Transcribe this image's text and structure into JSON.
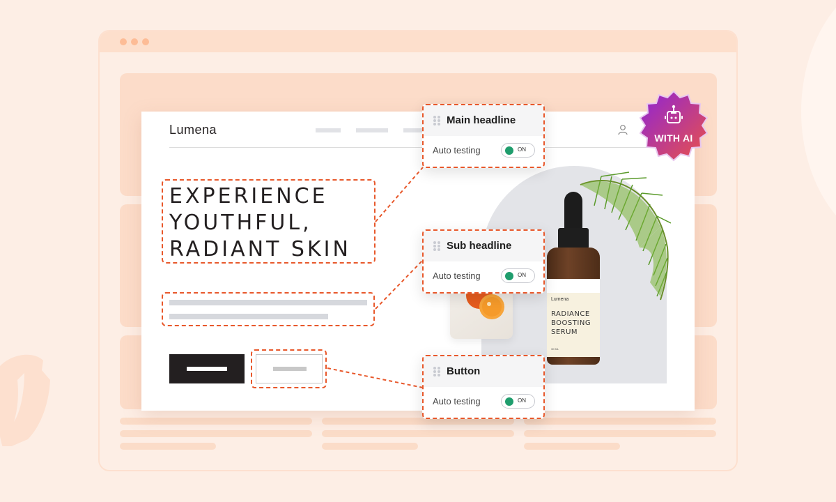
{
  "browser": {
    "window_dots": [
      "close",
      "minimize",
      "maximize"
    ]
  },
  "site": {
    "logo": "Lumena",
    "nav_item_count": 3,
    "user_icon": "user-icon",
    "hero": {
      "title_lines": [
        "EXPERIENCE",
        "YOUTHFUL,",
        "RADIANT SKIN"
      ]
    }
  },
  "product": {
    "brand": "Lumena",
    "name_lines": [
      "RADIANCE",
      "BOOSTING",
      "SERUM"
    ],
    "volume": "30 ML"
  },
  "panels": [
    {
      "title": "Main headline",
      "label": "Auto testing",
      "toggle": "ON",
      "toggle_state": true
    },
    {
      "title": "Sub headline",
      "label": "Auto testing",
      "toggle": "ON",
      "toggle_state": true
    },
    {
      "title": "Button",
      "label": "Auto testing",
      "toggle": "ON",
      "toggle_state": true
    }
  ],
  "badge": {
    "icon": "robot-icon",
    "text": "WITH AI"
  },
  "colors": {
    "accent_dashed": "#e8582b",
    "toggle_on": "#1f9d6d",
    "badge_gradient": [
      "#8e24d6",
      "#e8524b"
    ],
    "background": "#fdeee5"
  }
}
